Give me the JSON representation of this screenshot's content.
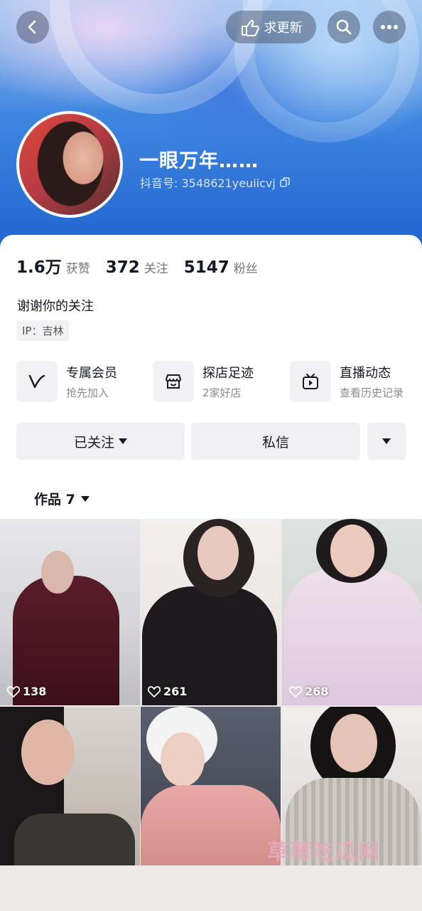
{
  "header": {
    "update_label": "求更新"
  },
  "profile": {
    "nickname": "一眼万年……",
    "douyin_id": "抖音号: 3548621yeuiicvj"
  },
  "stats": [
    {
      "num": "1.6万",
      "label": "获赞"
    },
    {
      "num": "372",
      "label": "关注"
    },
    {
      "num": "5147",
      "label": "粉丝"
    }
  ],
  "bio": "谢谢你的关注",
  "ip": "IP：吉林",
  "features": [
    {
      "title": "专属会员",
      "sub": "抢先加入",
      "icon": "v-member-icon"
    },
    {
      "title": "探店足迹",
      "sub": "2家好店",
      "icon": "shop-icon"
    },
    {
      "title": "直播动态",
      "sub": "查看历史记录",
      "icon": "live-tv-icon"
    }
  ],
  "actions": {
    "follow_label": "已关注",
    "message_label": "私信"
  },
  "works_tab": "作品 7",
  "videos": [
    {
      "likes": "138"
    },
    {
      "likes": "261"
    },
    {
      "likes": "268"
    },
    {
      "likes": ""
    },
    {
      "likes": ""
    },
    {
      "likes": ""
    }
  ],
  "watermark": "草莓吃瓜网",
  "colors": {
    "hero_blue": "#1f63cf",
    "text_primary": "#161823",
    "text_secondary": "#8a8b91",
    "button_bg": "#f0f0f2"
  }
}
